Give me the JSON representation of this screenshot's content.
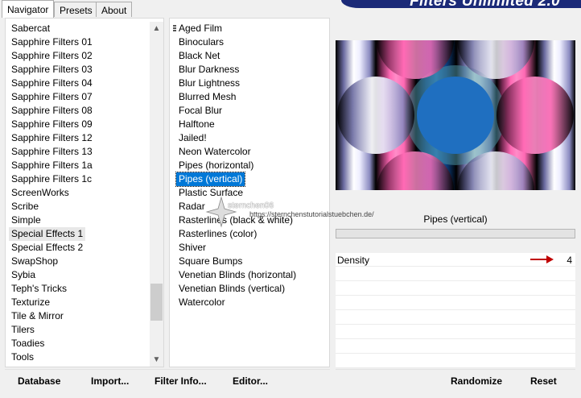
{
  "tabs": [
    {
      "label": "Navigator",
      "active": true
    },
    {
      "label": "Presets",
      "active": false
    },
    {
      "label": "About",
      "active": false
    }
  ],
  "banner_title": "Filters Unlimited 2.0",
  "categories": [
    "Sabercat",
    "Sapphire Filters 01",
    "Sapphire Filters 02",
    "Sapphire Filters 03",
    "Sapphire Filters 04",
    "Sapphire Filters 07",
    "Sapphire Filters 08",
    "Sapphire Filters 09",
    "Sapphire Filters 12",
    "Sapphire Filters 13",
    "Sapphire Filters 1a",
    "Sapphire Filters 1c",
    "ScreenWorks",
    "Scribe",
    "Simple",
    "Special Effects 1",
    "Special Effects 2",
    "SwapShop",
    "Sybia",
    "Teph's Tricks",
    "Texturize",
    "Tile & Mirror",
    "Tilers",
    "Toadies",
    "Tools"
  ],
  "selected_category": "Special Effects 1",
  "filters": [
    "Aged Film",
    "Binoculars",
    "Black Net",
    "Blur Darkness",
    "Blur Lightness",
    "Blurred Mesh",
    "Focal Blur",
    "Halftone",
    "Jailed!",
    "Neon Watercolor",
    "Pipes (horizontal)",
    "Pipes (vertical)",
    "Plastic Surface",
    "Radar",
    "Rasterlines (black & white)",
    "Rasterlines (color)",
    "Shiver",
    "Square Bumps",
    "Venetian Blinds (horizontal)",
    "Venetian Blinds (vertical)",
    "Watercolor"
  ],
  "selected_filter": "Pipes (vertical)",
  "filter_name": "Pipes (vertical)",
  "params": [
    {
      "label": "Density",
      "value": "4"
    }
  ],
  "buttons": {
    "database": "Database",
    "import": "Import...",
    "filter_info": "Filter Info...",
    "editor": "Editor...",
    "randomize": "Randomize",
    "reset": "Reset"
  },
  "watermark": {
    "name": "sternchen06",
    "url": "https://sternchenstutorialstuebchen.de/"
  },
  "colors": {
    "selection": "#0078d7",
    "banner": "#1b2a78",
    "arrow": "#c00000",
    "pink": "#ff69b4",
    "blue": "#1f6fc0",
    "teal": "#3f7f8f"
  }
}
